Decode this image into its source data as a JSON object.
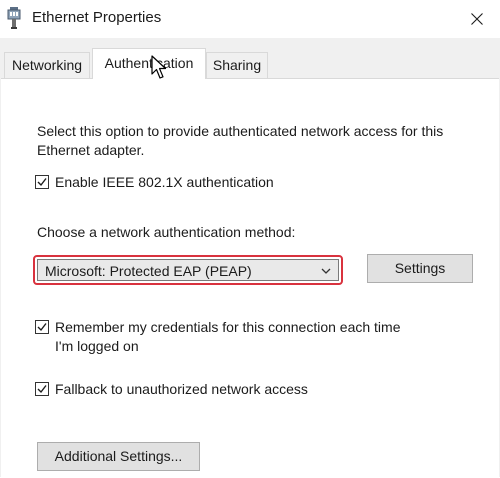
{
  "window": {
    "title": "Ethernet Properties",
    "icon": "network-adapter-icon"
  },
  "tabs": [
    {
      "label": "Networking",
      "active": false
    },
    {
      "label": "Authentication",
      "active": true
    },
    {
      "label": "Sharing",
      "active": false
    }
  ],
  "authentication": {
    "description": "Select this option to provide authenticated network access for this Ethernet adapter.",
    "enable_8021x": {
      "label": "Enable IEEE 802.1X authentication",
      "checked": true
    },
    "method_label": "Choose a network authentication method:",
    "method_select": {
      "value": "Microsoft: Protected EAP (PEAP)",
      "highlight_color": "#d9323e"
    },
    "settings_button": "Settings",
    "remember_credentials": {
      "label": "Remember my credentials for this connection each time I'm logged on",
      "checked": true
    },
    "fallback": {
      "label": "Fallback to unauthorized network access",
      "checked": true
    },
    "additional_settings_button": "Additional Settings..."
  }
}
